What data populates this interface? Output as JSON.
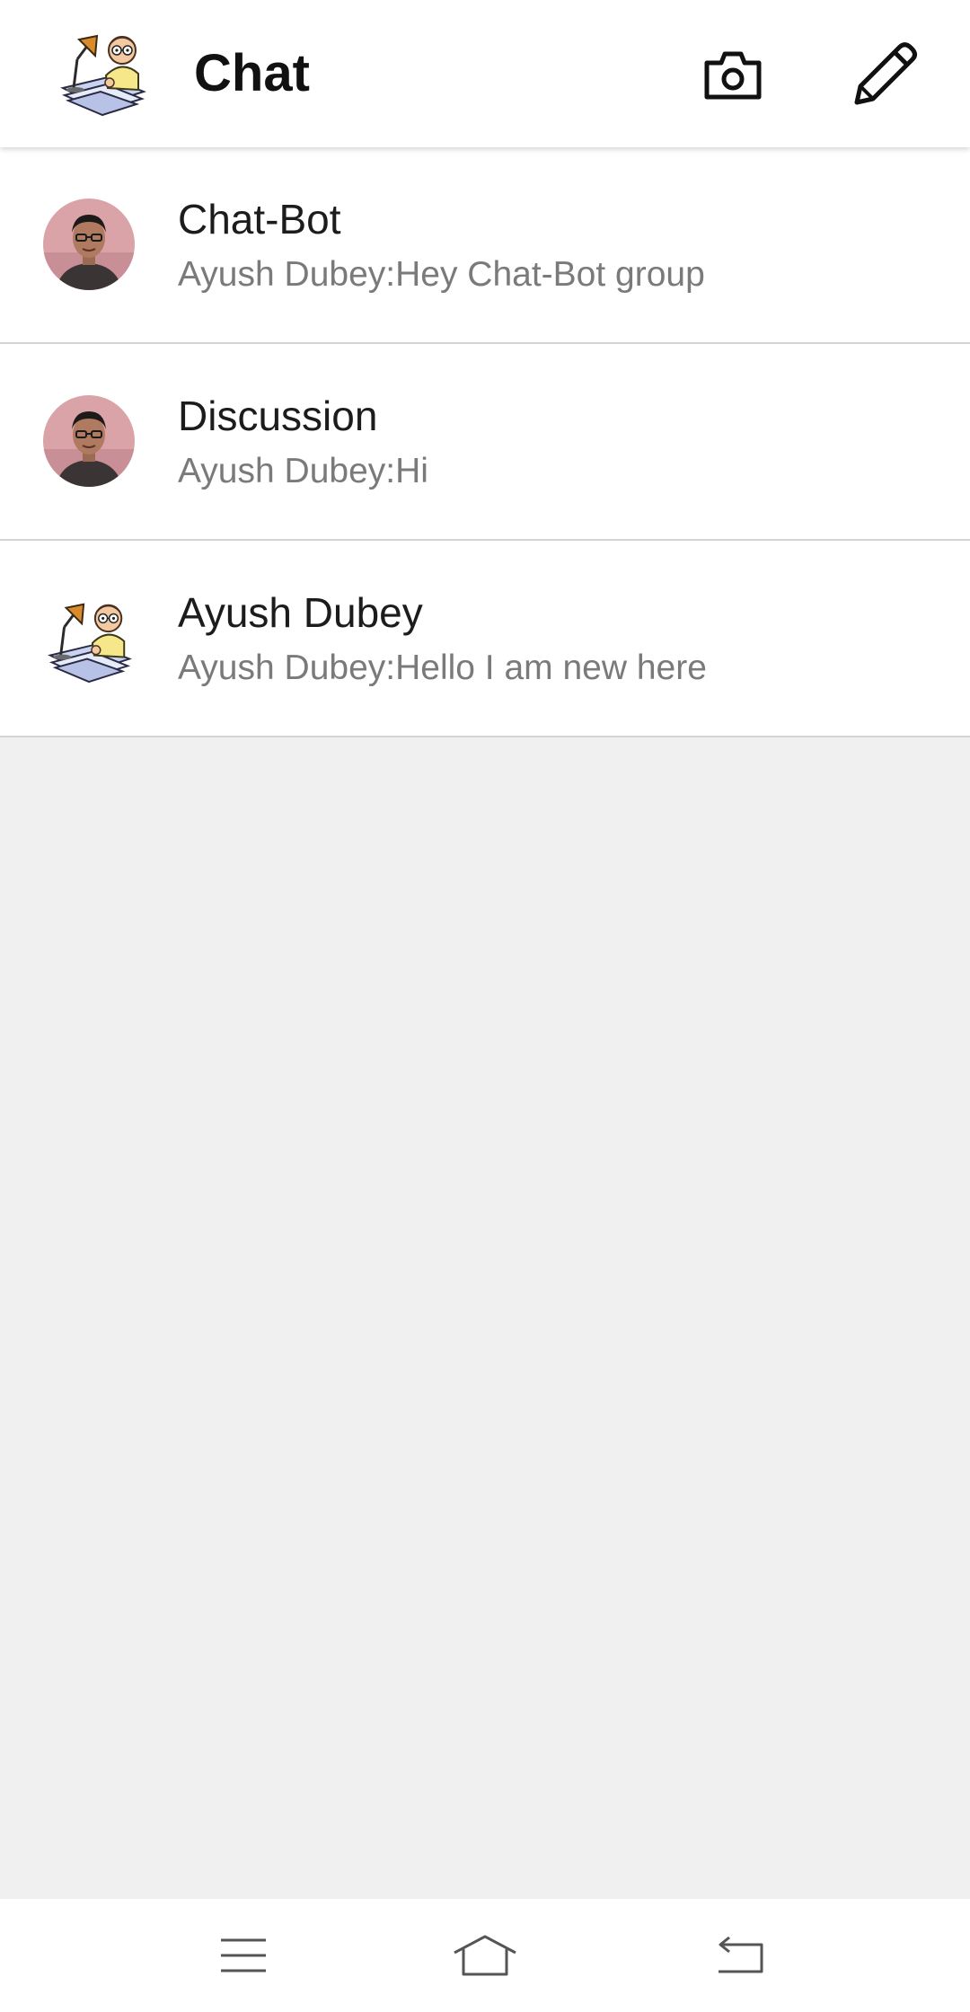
{
  "header": {
    "title": "Chat",
    "logo_icon": "cartoon-writer-logo",
    "actions": [
      {
        "name": "camera",
        "icon": "camera-icon"
      },
      {
        "name": "compose",
        "icon": "pencil-icon"
      }
    ]
  },
  "chats": [
    {
      "name": "Chat-Bot",
      "preview": "Ayush Dubey:Hey Chat-Bot group",
      "avatar": "person-photo"
    },
    {
      "name": "Discussion",
      "preview": "Ayush Dubey:Hi",
      "avatar": "person-photo"
    },
    {
      "name": "Ayush Dubey",
      "preview": "Ayush Dubey:Hello I am new here",
      "avatar": "cartoon-writer"
    }
  ],
  "navigation": {
    "buttons": [
      "menu-icon",
      "home-icon",
      "back-icon"
    ]
  },
  "colors": {
    "background": "#f0f0f0",
    "surface": "#ffffff",
    "title_text": "#111111",
    "name_text": "#1c1c1c",
    "preview_text": "#7a7a7a",
    "divider": "#d4d4d4"
  }
}
